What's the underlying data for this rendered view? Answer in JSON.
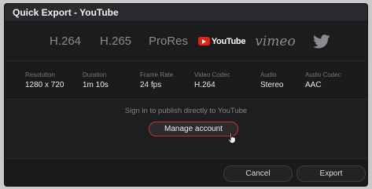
{
  "window": {
    "title": "Quick Export - YouTube"
  },
  "tabs": [
    {
      "label": "H.264",
      "active": false
    },
    {
      "label": "H.265",
      "active": false
    },
    {
      "label": "ProRes",
      "active": false
    },
    {
      "label": "YouTube",
      "icon": "youtube-logo",
      "active": true
    },
    {
      "label": "vimeo",
      "active": false
    },
    {
      "label": "",
      "icon": "twitter-bird-icon",
      "active": false
    }
  ],
  "info": [
    {
      "label": "Resolution",
      "value": "1280 x 720"
    },
    {
      "label": "Duration",
      "value": "1m 10s"
    },
    {
      "label": "Frame Rate",
      "value": "24 fps"
    },
    {
      "label": "Video Codec",
      "value": "H.264"
    },
    {
      "label": "Audio",
      "value": "Stereo"
    },
    {
      "label": "Audio Codec",
      "value": "AAC"
    }
  ],
  "signin": {
    "message": "Sign in to publish directly to YouTube",
    "manage_label": "Manage account"
  },
  "footer": {
    "cancel_label": "Cancel",
    "export_label": "Export"
  },
  "colors": {
    "accent_red": "#c9302c",
    "youtube_red": "#e62117",
    "background": "#1e1e20",
    "title_bar": "#2a2a2e"
  }
}
